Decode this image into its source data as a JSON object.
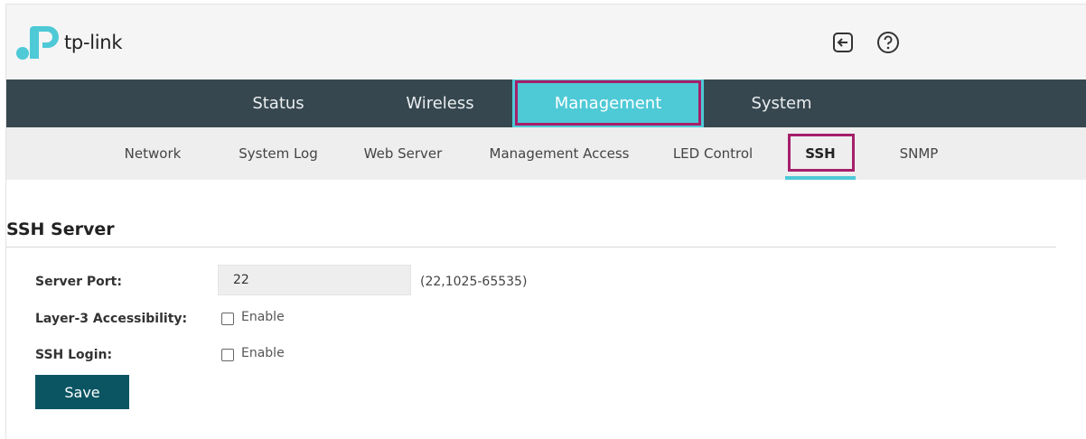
{
  "brand": {
    "logo_text": "tp-link",
    "primary_color": "#4ec9d6",
    "dark_color": "#37474f",
    "highlight_color": "#a51f6a"
  },
  "header": {
    "icons": [
      "logout-icon",
      "help-icon"
    ]
  },
  "main_nav": {
    "tabs": [
      {
        "label": "Status"
      },
      {
        "label": "Wireless"
      },
      {
        "label": "Management",
        "active": true
      },
      {
        "label": "System"
      }
    ]
  },
  "sub_nav": {
    "tabs": [
      {
        "label": "Network"
      },
      {
        "label": "System Log"
      },
      {
        "label": "Web Server"
      },
      {
        "label": "Management Access"
      },
      {
        "label": "LED Control"
      },
      {
        "label": "SSH",
        "active": true
      },
      {
        "label": "SNMP"
      }
    ]
  },
  "ssh_server": {
    "title": "SSH Server",
    "server_port": {
      "label": "Server Port:",
      "value": "22",
      "hint": "(22,1025-65535)"
    },
    "layer3_accessibility": {
      "label": "Layer-3 Accessibility:",
      "option": "Enable",
      "checked": false
    },
    "ssh_login": {
      "label": "SSH Login:",
      "option": "Enable",
      "checked": false
    },
    "save_label": "Save"
  }
}
